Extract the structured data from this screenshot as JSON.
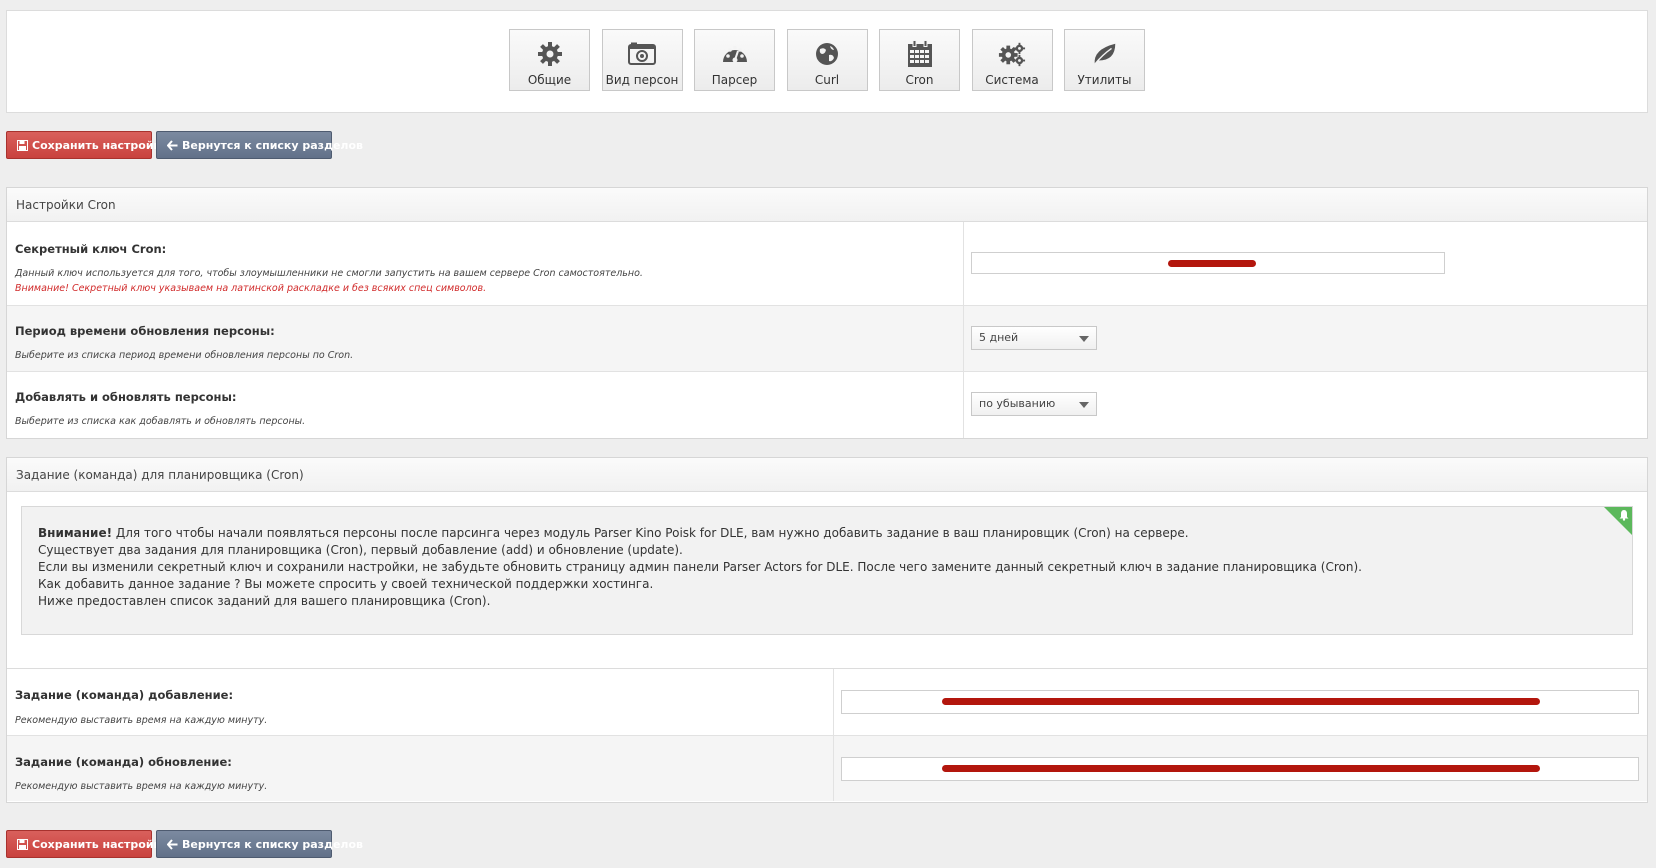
{
  "nav": {
    "tiles": [
      {
        "label": "Общие",
        "icon": "gear-icon"
      },
      {
        "label": "Вид персон",
        "icon": "camera-icon"
      },
      {
        "label": "Парсер",
        "icon": "dashboard-icon"
      },
      {
        "label": "Curl",
        "icon": "globe-icon"
      },
      {
        "label": "Cron",
        "icon": "calendar-icon"
      },
      {
        "label": "Система",
        "icon": "gears-icon"
      },
      {
        "label": "Утилиты",
        "icon": "leaf-icon"
      }
    ]
  },
  "buttons": {
    "save_label": "Сохранить настройки",
    "back_label": "Вернутся к списку разделов"
  },
  "cron_settings": {
    "title": "Настройки Cron",
    "secret_key": {
      "label": "Секретный ключ Cron:",
      "description": "Данный ключ используется для того, чтобы злоумышленники не смогли запустить на вашем сервере Cron самостоятельно.",
      "warning": "Внимание! Секретный ключ указываем на латинской раскладке и без всяких спец символов.",
      "value": ""
    },
    "period": {
      "label": "Период времени обновления персоны:",
      "description": "Выберите из списка период времени обновления персоны по Cron.",
      "selected": "5 дней"
    },
    "order": {
      "label": "Добавлять и обновлять персоны:",
      "description": "Выберите из списка как добавлять и обновлять персоны.",
      "selected": "по убыванию"
    }
  },
  "cron_tasks": {
    "title": "Задание (команда) для планировщика (Cron)",
    "alert": {
      "strong": "Внимание!",
      "line1": " Для того чтобы начали появляться персоны после парсинга через модуль Parser Kino Poisk for DLE, вам нужно добавить задание в ваш планировщик (Cron) на сервере.",
      "line2": "Существует два задания для планировщика (Cron), первый добавление (add) и обновление (update).",
      "line3": "Если вы изменили секретный ключ и сохранили настройки, не забудьте обновить страницу админ панели Parser Actors for DLE. После чего замените данный секретный ключ в задание планировщика (Cron).",
      "line4": "Как добавить данное задание ? Вы можете спросить у своей технической поддержки хостинга.",
      "line5": "Ниже предоставлен список заданий для вашего планировщика (Cron)."
    },
    "add": {
      "label": "Задание (команда) добавление:",
      "description": "Рекомендую выставить время на каждую минуту.",
      "value": ""
    },
    "update": {
      "label": "Задание (команда) обновление:",
      "description": "Рекомендую выставить время на каждую минуту.",
      "value": ""
    }
  },
  "colors": {
    "save_button": "#c9423e",
    "back_button": "#627189",
    "warning_text": "#d12b2b",
    "alert_corner": "#5cb85c",
    "redaction": "#b3160d"
  }
}
